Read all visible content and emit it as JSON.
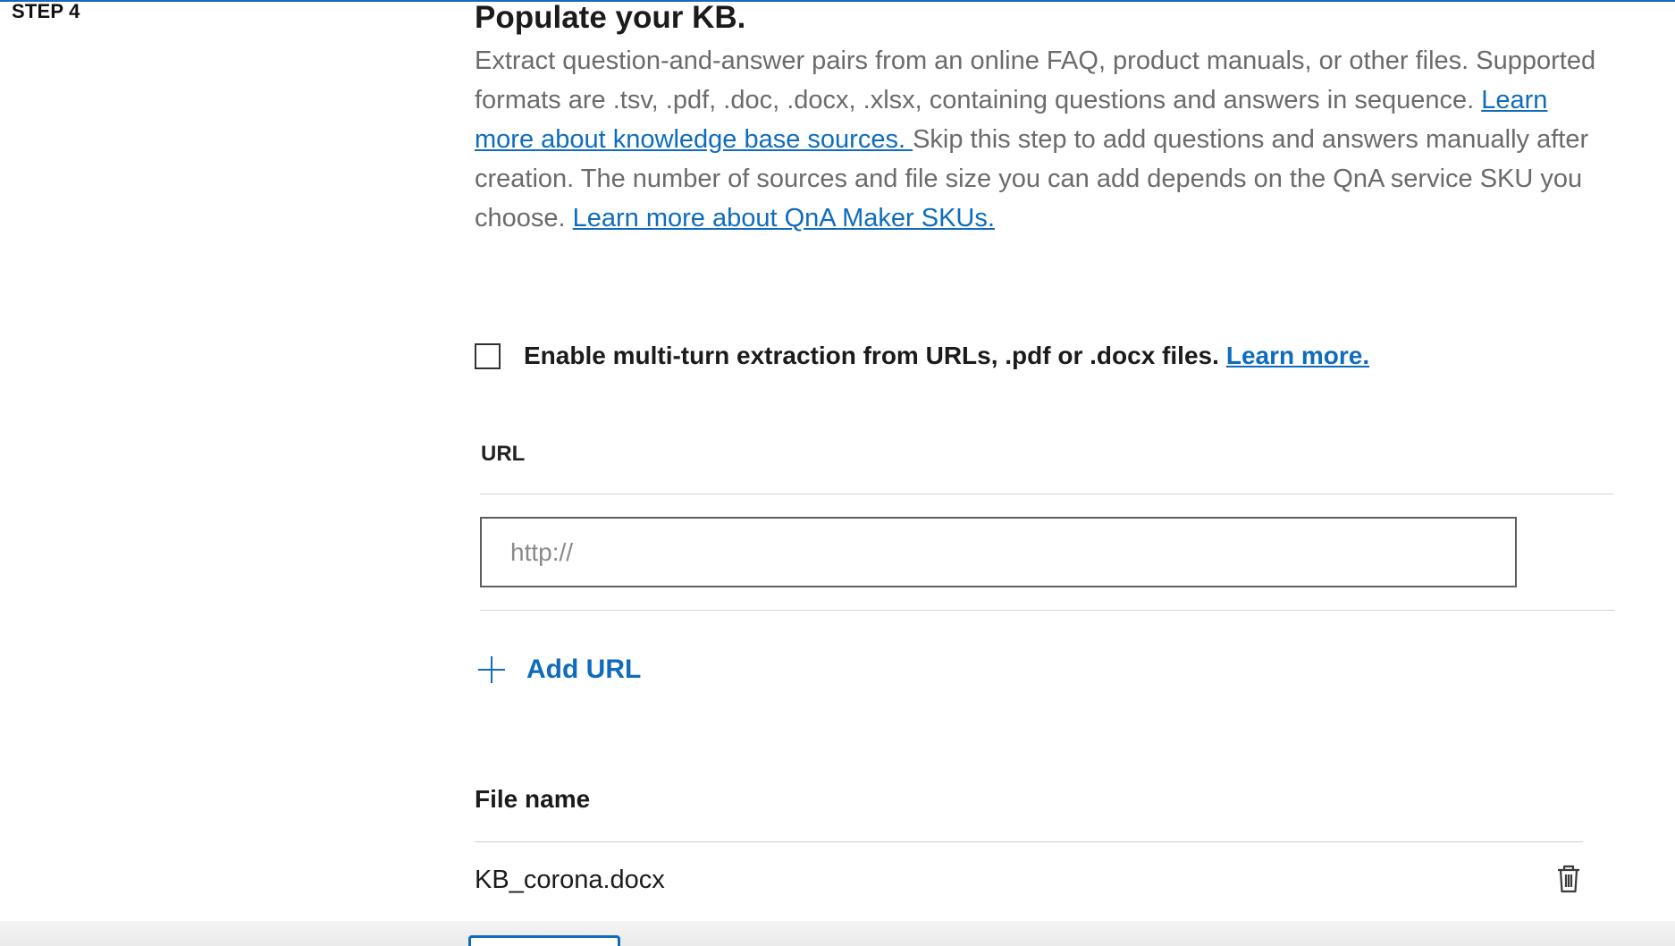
{
  "step": {
    "label": "STEP 4"
  },
  "section": {
    "heading": "Populate your KB.",
    "description_part1": "Extract question-and-answer pairs from an online FAQ, product manuals, or other files. Supported formats are .tsv, .pdf, .doc, .docx, .xlsx, containing questions and answers in sequence. ",
    "sources_link": "Learn more about knowledge base sources. ",
    "description_part2": "Skip this step to add questions and answers manually after creation. The number of sources and file size you can add depends on the QnA service SKU you choose. ",
    "sku_link": "Learn more about QnA Maker SKUs."
  },
  "multiturn": {
    "checked": false,
    "label": "Enable multi-turn extraction from URLs, .pdf or .docx files.",
    "link": "Learn more."
  },
  "url_section": {
    "label": "URL",
    "input_value": "",
    "input_placeholder": "http://",
    "add_url_label": "Add URL"
  },
  "files": {
    "header": "File name",
    "rows": [
      {
        "name": "KB_corona.docx"
      }
    ]
  },
  "icons": {
    "add": "plus-icon",
    "delete": "trash-icon"
  },
  "colors": {
    "accent": "#0f6cbd",
    "text": "#1b1b1b",
    "muted": "#6b6b6b"
  }
}
